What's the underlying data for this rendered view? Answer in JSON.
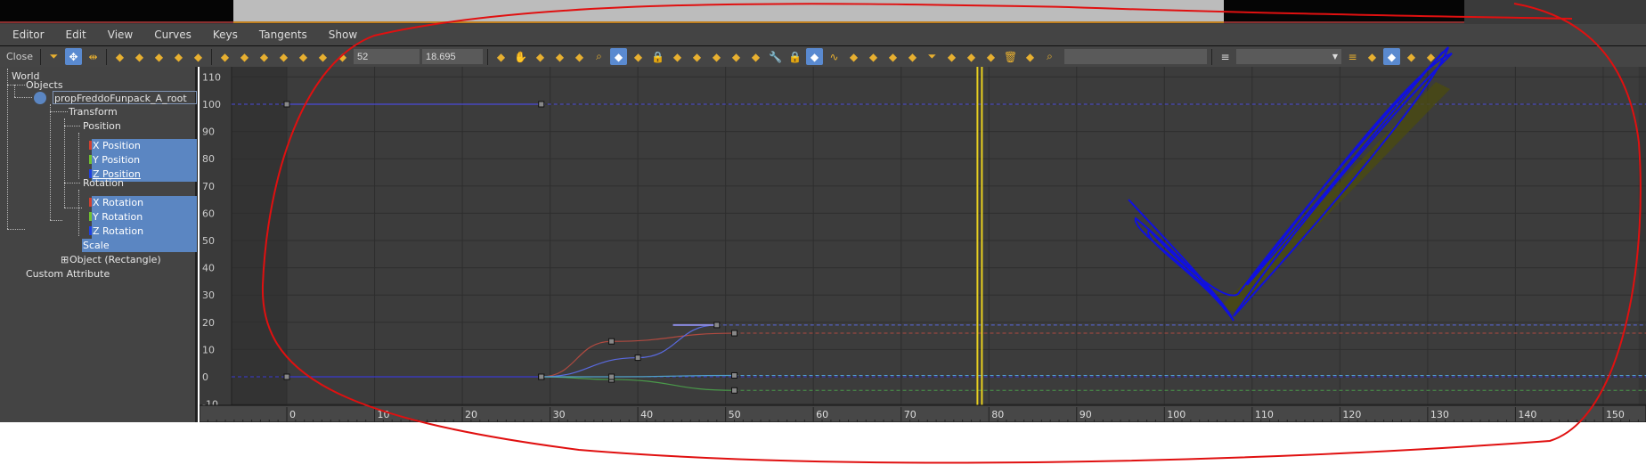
{
  "menu": [
    "Editor",
    "Edit",
    "View",
    "Curves",
    "Keys",
    "Tangents",
    "Show"
  ],
  "toolbar": {
    "close_label": "Close",
    "frame_value": "52",
    "key_value": "18.695",
    "name_field": "",
    "dropdown_value": "",
    "icons_a": [
      "filter-icon",
      "move-keys-icon",
      "slide-keys-icon"
    ],
    "icons_b": [
      "scale-keys-icon",
      "scale-values-icon",
      "add-keys-icon",
      "draw-curves-icon",
      "reduce-keys-icon"
    ],
    "icons_c": [
      "tangent-auto-icon",
      "tangent-spline-icon",
      "tangent-fast-icon",
      "tangent-slow-icon",
      "tangent-step-icon",
      "tangent-linear-icon",
      "tangent-smooth-icon"
    ],
    "icons_d": [
      "key-tool-icon",
      "pan-icon",
      "zoom-extents-icon",
      "zoom-horizontal-icon",
      "zoom-value-icon",
      "zoom-icon",
      "zoom-region-icon",
      "isolate-curve-icon",
      "lock-icon",
      "lock-selection-icon",
      "pin-icon",
      "show-tangents-icon",
      "lock-tangents-icon",
      "snap-frames-icon",
      "wrench-icon",
      "lock-icon",
      "show-keys-icon",
      "curve-icon",
      "gauge-icon",
      "ease-icon",
      "multiplier-icon",
      "lock-tangent-icon",
      "filter-icon",
      "clipboard-icon",
      "clipboard-paste-icon",
      "brush-icon",
      "trash-icon",
      "group-icon",
      "search-icon"
    ],
    "icons_e": [
      "list-icon",
      "filter-list-icon",
      "filter-selected-icon",
      "filter-animated-icon",
      "filter-layers-icon"
    ]
  },
  "tree": {
    "world": "World",
    "objects": "Objects",
    "root": "propFreddoFunpack_A_root",
    "transform": "Transform",
    "position": "Position",
    "x_position": "X Position",
    "y_position": "Y Position",
    "z_position": "Z Position",
    "rotation": "Rotation",
    "x_rotation": "X Rotation",
    "y_rotation": "Y Rotation",
    "z_rotation": "Z Rotation",
    "scale": "Scale",
    "object": "Object (Rectangle)",
    "custom": "Custom Attribute"
  },
  "colors": {
    "x": "#d04030",
    "y": "#70c030",
    "z": "#2040e0",
    "annotation_red": "#e01010",
    "annotation_blue": "#1010e0",
    "time_slider": "#e8d020",
    "selection": "#5b86c2"
  },
  "chart_data": {
    "type": "line",
    "x_ticks": [
      0,
      10,
      20,
      30,
      40,
      50,
      60,
      70,
      80,
      90,
      100,
      110,
      120,
      130,
      140,
      150
    ],
    "y_ticks": [
      -10,
      0,
      10,
      20,
      30,
      40,
      50,
      60,
      70,
      80,
      90,
      100,
      110
    ],
    "xlim": [
      -9,
      157
    ],
    "ylim": [
      -13,
      112
    ],
    "current_frame": 79,
    "grid": true,
    "series": [
      {
        "color": "#4a4ad8",
        "keys": [
          [
            0,
            100
          ],
          [
            29,
            100
          ]
        ],
        "extend": 100
      },
      {
        "color": "#3a3ad0",
        "keys": [
          [
            0,
            0
          ],
          [
            29,
            0
          ]
        ],
        "extend": 0
      },
      {
        "color": "#b04a40",
        "keys": [
          [
            29,
            0
          ],
          [
            37,
            13
          ],
          [
            51,
            16
          ]
        ],
        "extend": 16
      },
      {
        "color": "#5a6ae0",
        "keys": [
          [
            29,
            0
          ],
          [
            40,
            7
          ],
          [
            49,
            19
          ]
        ],
        "extend": 19,
        "handle": [
          44,
          19
        ]
      },
      {
        "color": "#4a9a4a",
        "keys": [
          [
            29,
            0
          ],
          [
            37,
            -1
          ],
          [
            51,
            -5
          ]
        ],
        "extend": -5
      },
      {
        "color": "#50a0c8",
        "keys": [
          [
            29,
            0
          ],
          [
            37,
            0
          ],
          [
            51,
            0.5
          ]
        ],
        "extend": 0.5
      }
    ]
  }
}
